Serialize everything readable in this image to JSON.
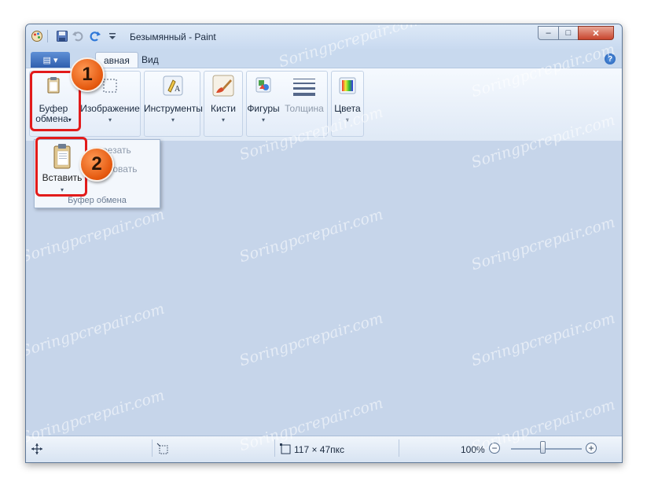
{
  "window": {
    "title": "Безымянный - Paint",
    "min_label": "–",
    "max_label": "□",
    "close_label": "✕"
  },
  "tabs": {
    "file_label": "▤ ▾",
    "home": "Главная",
    "home_visible": "авная",
    "view": "Вид",
    "help": "?"
  },
  "ribbon": {
    "clipboard": "Буфер обмена",
    "clipboard_line1": "Буфер",
    "clipboard_line2": "обмена",
    "image": "Изображение",
    "tools": "Инструменты",
    "brushes": "Кисти",
    "shapes": "Фигуры",
    "size": "Толщина",
    "colors": "Цвета",
    "arrow": "▾"
  },
  "dropdown": {
    "paste": "Вставить",
    "cut_visible": "резать",
    "copy_visible": "ировать",
    "group_label": "Буфер обмена"
  },
  "status": {
    "dimensions": "117 × 47пкс",
    "zoom": "100%"
  },
  "callouts": [
    "1",
    "2"
  ],
  "watermark": "Soringpcrepair.com",
  "colors": {
    "highlight": "#e21b1b",
    "callout": "#e4570d",
    "canvas": "#c6d5ea"
  }
}
